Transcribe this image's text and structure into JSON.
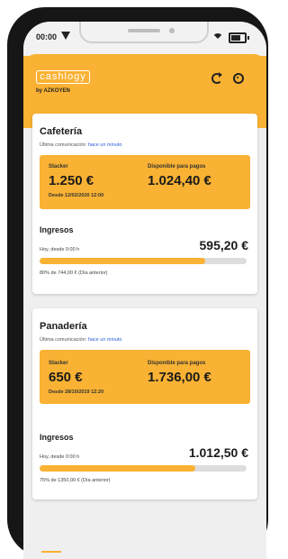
{
  "status": {
    "time": "00:00"
  },
  "app": {
    "logo": "cashlogy",
    "byline": "by AZKOYEN"
  },
  "icons": {
    "refresh": "refresh-icon",
    "settings": "settings-icon"
  },
  "colors": {
    "accent": "#f9b233"
  },
  "shops": [
    {
      "name": "Cafetería",
      "last_comm_label": "Última comunicación:",
      "last_comm_value": "hace un minuto",
      "stacker_label": "Stacker",
      "stacker_value": "1.250 €",
      "stacker_since": "Desde 12/02/2020 12:00",
      "available_label": "Disponible para pagos",
      "available_value": "1.024,40 €",
      "income_title": "Ingresos",
      "income_today": "Hoy, desde 0:00 h",
      "income_total": "595,20 €",
      "progress_fraction": 0.8,
      "progress_text": "80% de 744,00 € (Día anterior)"
    },
    {
      "name": "Panadería",
      "last_comm_label": "Última comunicación:",
      "last_comm_value": "hace un minuto",
      "stacker_label": "Stacker",
      "stacker_value": "650 €",
      "stacker_since": "Desde 28/10/2019 12:20",
      "available_label": "Disponible para pagos",
      "available_value": "1.736,00 €",
      "income_title": "Ingresos",
      "income_today": "Hoy, desde 0:00 h",
      "income_total": "1.012,50 €",
      "progress_fraction": 0.75,
      "progress_text": "75% de 1350,00 € (Día anterior)"
    }
  ]
}
